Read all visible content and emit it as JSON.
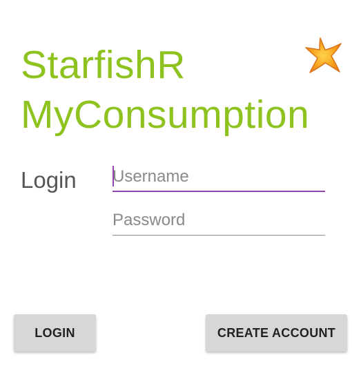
{
  "app": {
    "title_line1": "StarfishR",
    "title_line2": "MyConsumption",
    "title_color": "#8dc21f",
    "logo_icon": "starfish-icon"
  },
  "form": {
    "label": "Login",
    "username_placeholder": "Username",
    "username_value": "",
    "password_placeholder": "Password",
    "password_value": "",
    "focus_color": "#8e44ad"
  },
  "buttons": {
    "login_label": "LOGIN",
    "create_account_label": "CREATE ACCOUNT"
  }
}
